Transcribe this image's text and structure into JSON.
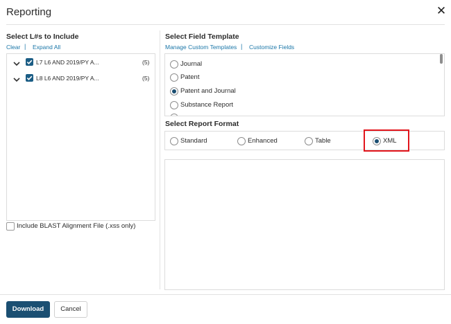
{
  "dialog": {
    "title": "Reporting",
    "close_icon": "close-icon"
  },
  "left": {
    "heading": "Select L#s to Include",
    "actions": {
      "clear": "Clear",
      "separator": "|",
      "expand_all": "Expand All"
    },
    "items": [
      {
        "label": "L7  L6 AND 2019/PY A...",
        "count": "(5)",
        "checked": true
      },
      {
        "label": "L8  L6 AND 2019/PY A...",
        "count": "(5)",
        "checked": true
      }
    ],
    "blast_option": {
      "label": "Include BLAST Alignment File (.xss only)",
      "checked": false
    }
  },
  "right": {
    "field_template": {
      "heading": "Select Field Template",
      "manage_link": "Manage Custom Templates",
      "separator": "|",
      "customize_link": "Customize Fields",
      "options": [
        {
          "label": "Journal",
          "selected": false
        },
        {
          "label": "Patent",
          "selected": false
        },
        {
          "label": "Patent and Journal",
          "selected": true
        },
        {
          "label": "Substance Report",
          "selected": false
        }
      ]
    },
    "report_format": {
      "heading": "Select Report Format",
      "options": [
        {
          "label": "Standard",
          "selected": false
        },
        {
          "label": "Enhanced",
          "selected": false
        },
        {
          "label": "Table",
          "selected": false
        },
        {
          "label": "XML",
          "selected": true
        }
      ],
      "highlight_color": "#e2141b"
    }
  },
  "footer": {
    "download": "Download",
    "cancel": "Cancel"
  },
  "colors": {
    "primary": "#1b4f72",
    "link": "#1a76a8",
    "checkbox": "#1b5d85"
  }
}
